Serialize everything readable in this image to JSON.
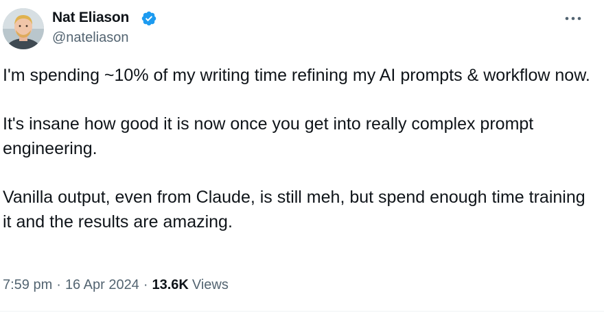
{
  "author": {
    "name": "Nat Eliason",
    "handle": "@nateliason",
    "verified": true
  },
  "tweet": {
    "paragraphs": [
      "I'm spending ~10% of my writing time refining my AI prompts & workflow now.",
      "It's insane how good it is now once you get into really complex prompt engineering.",
      "Vanilla output, even from Claude, is still meh, but spend enough time training it and the results are amazing."
    ]
  },
  "meta": {
    "time": "7:59 pm",
    "separator": "·",
    "date": "16 Apr 2024",
    "views_count": "13.6K",
    "views_label": "Views"
  },
  "icons": {
    "verified": "verified-badge-icon",
    "more": "more-options-icon"
  },
  "colors": {
    "text": "#0f1419",
    "secondary": "#536471",
    "verified": "#1d9bf0"
  }
}
